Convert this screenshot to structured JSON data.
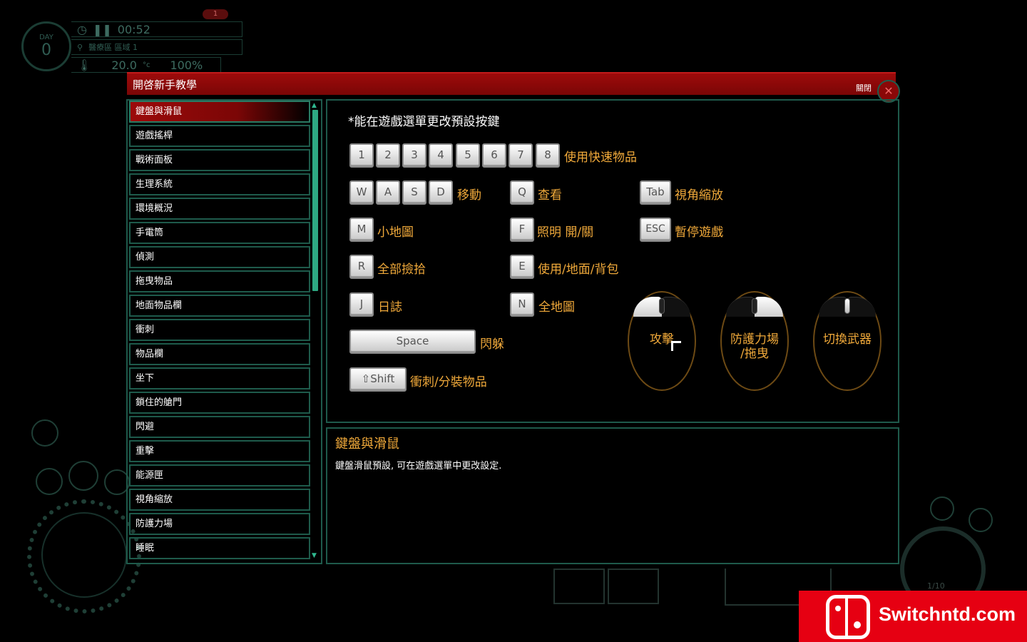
{
  "hud": {
    "day_label": "DAY",
    "day_value": "0",
    "time": "00:52",
    "location": "醫療區 區域 1",
    "temperature": "20.0",
    "temp_unit": "°c",
    "percent": "100%",
    "notification_count": "1",
    "item_counter": "1/10"
  },
  "dialog": {
    "title": "開啓新手教學",
    "close_label": "關閉"
  },
  "menu": [
    "鍵盤與滑鼠",
    "遊戲搖桿",
    "戰術面板",
    "生理系統",
    "環境概況",
    "手電筒",
    "偵測",
    "拖曳物品",
    "地面物品欄",
    "衝刺",
    "物品欄",
    "坐下",
    "鎖住的艙門",
    "閃避",
    "重擊",
    "能源匣",
    "視角縮放",
    "防護力場",
    "睡眠"
  ],
  "content": {
    "note": "*能在遊戲選單更改預設按鍵",
    "keys": {
      "n1": "1",
      "n2": "2",
      "n3": "3",
      "n4": "4",
      "n5": "5",
      "n6": "6",
      "n7": "7",
      "n8": "8",
      "w": "W",
      "a": "A",
      "s": "S",
      "d": "D",
      "q": "Q",
      "tab": "Tab",
      "m": "M",
      "f": "F",
      "esc": "ESC",
      "r": "R",
      "e": "E",
      "j": "J",
      "n": "N",
      "space": "Space",
      "shift": "⇧Shift"
    },
    "labels": {
      "quick_items": "使用快速物品",
      "move": "移動",
      "look": "查看",
      "zoom": "視角縮放",
      "minimap": "小地圖",
      "light": "照明 開/關",
      "pause": "暫停遊戲",
      "pickup_all": "全部撿拾",
      "use": "使用/地面/背包",
      "journal": "日誌",
      "full_map": "全地圖",
      "dodge": "閃躲",
      "sprint": "衝刺/分裝物品"
    },
    "mouse": {
      "attack": "攻擊",
      "shield": "防護力場\n/拖曳",
      "switch": "切換武器"
    }
  },
  "description": {
    "title": "鍵盤與滑鼠",
    "text": "鍵盤滑鼠預設, 可在遊戲選單中更改設定."
  },
  "watermark": {
    "text": "Switchntd.com"
  },
  "colors": {
    "accent_red": "#9e0b0b",
    "frame_green": "#1e5a4b",
    "label_orange": "#f0a93a"
  }
}
